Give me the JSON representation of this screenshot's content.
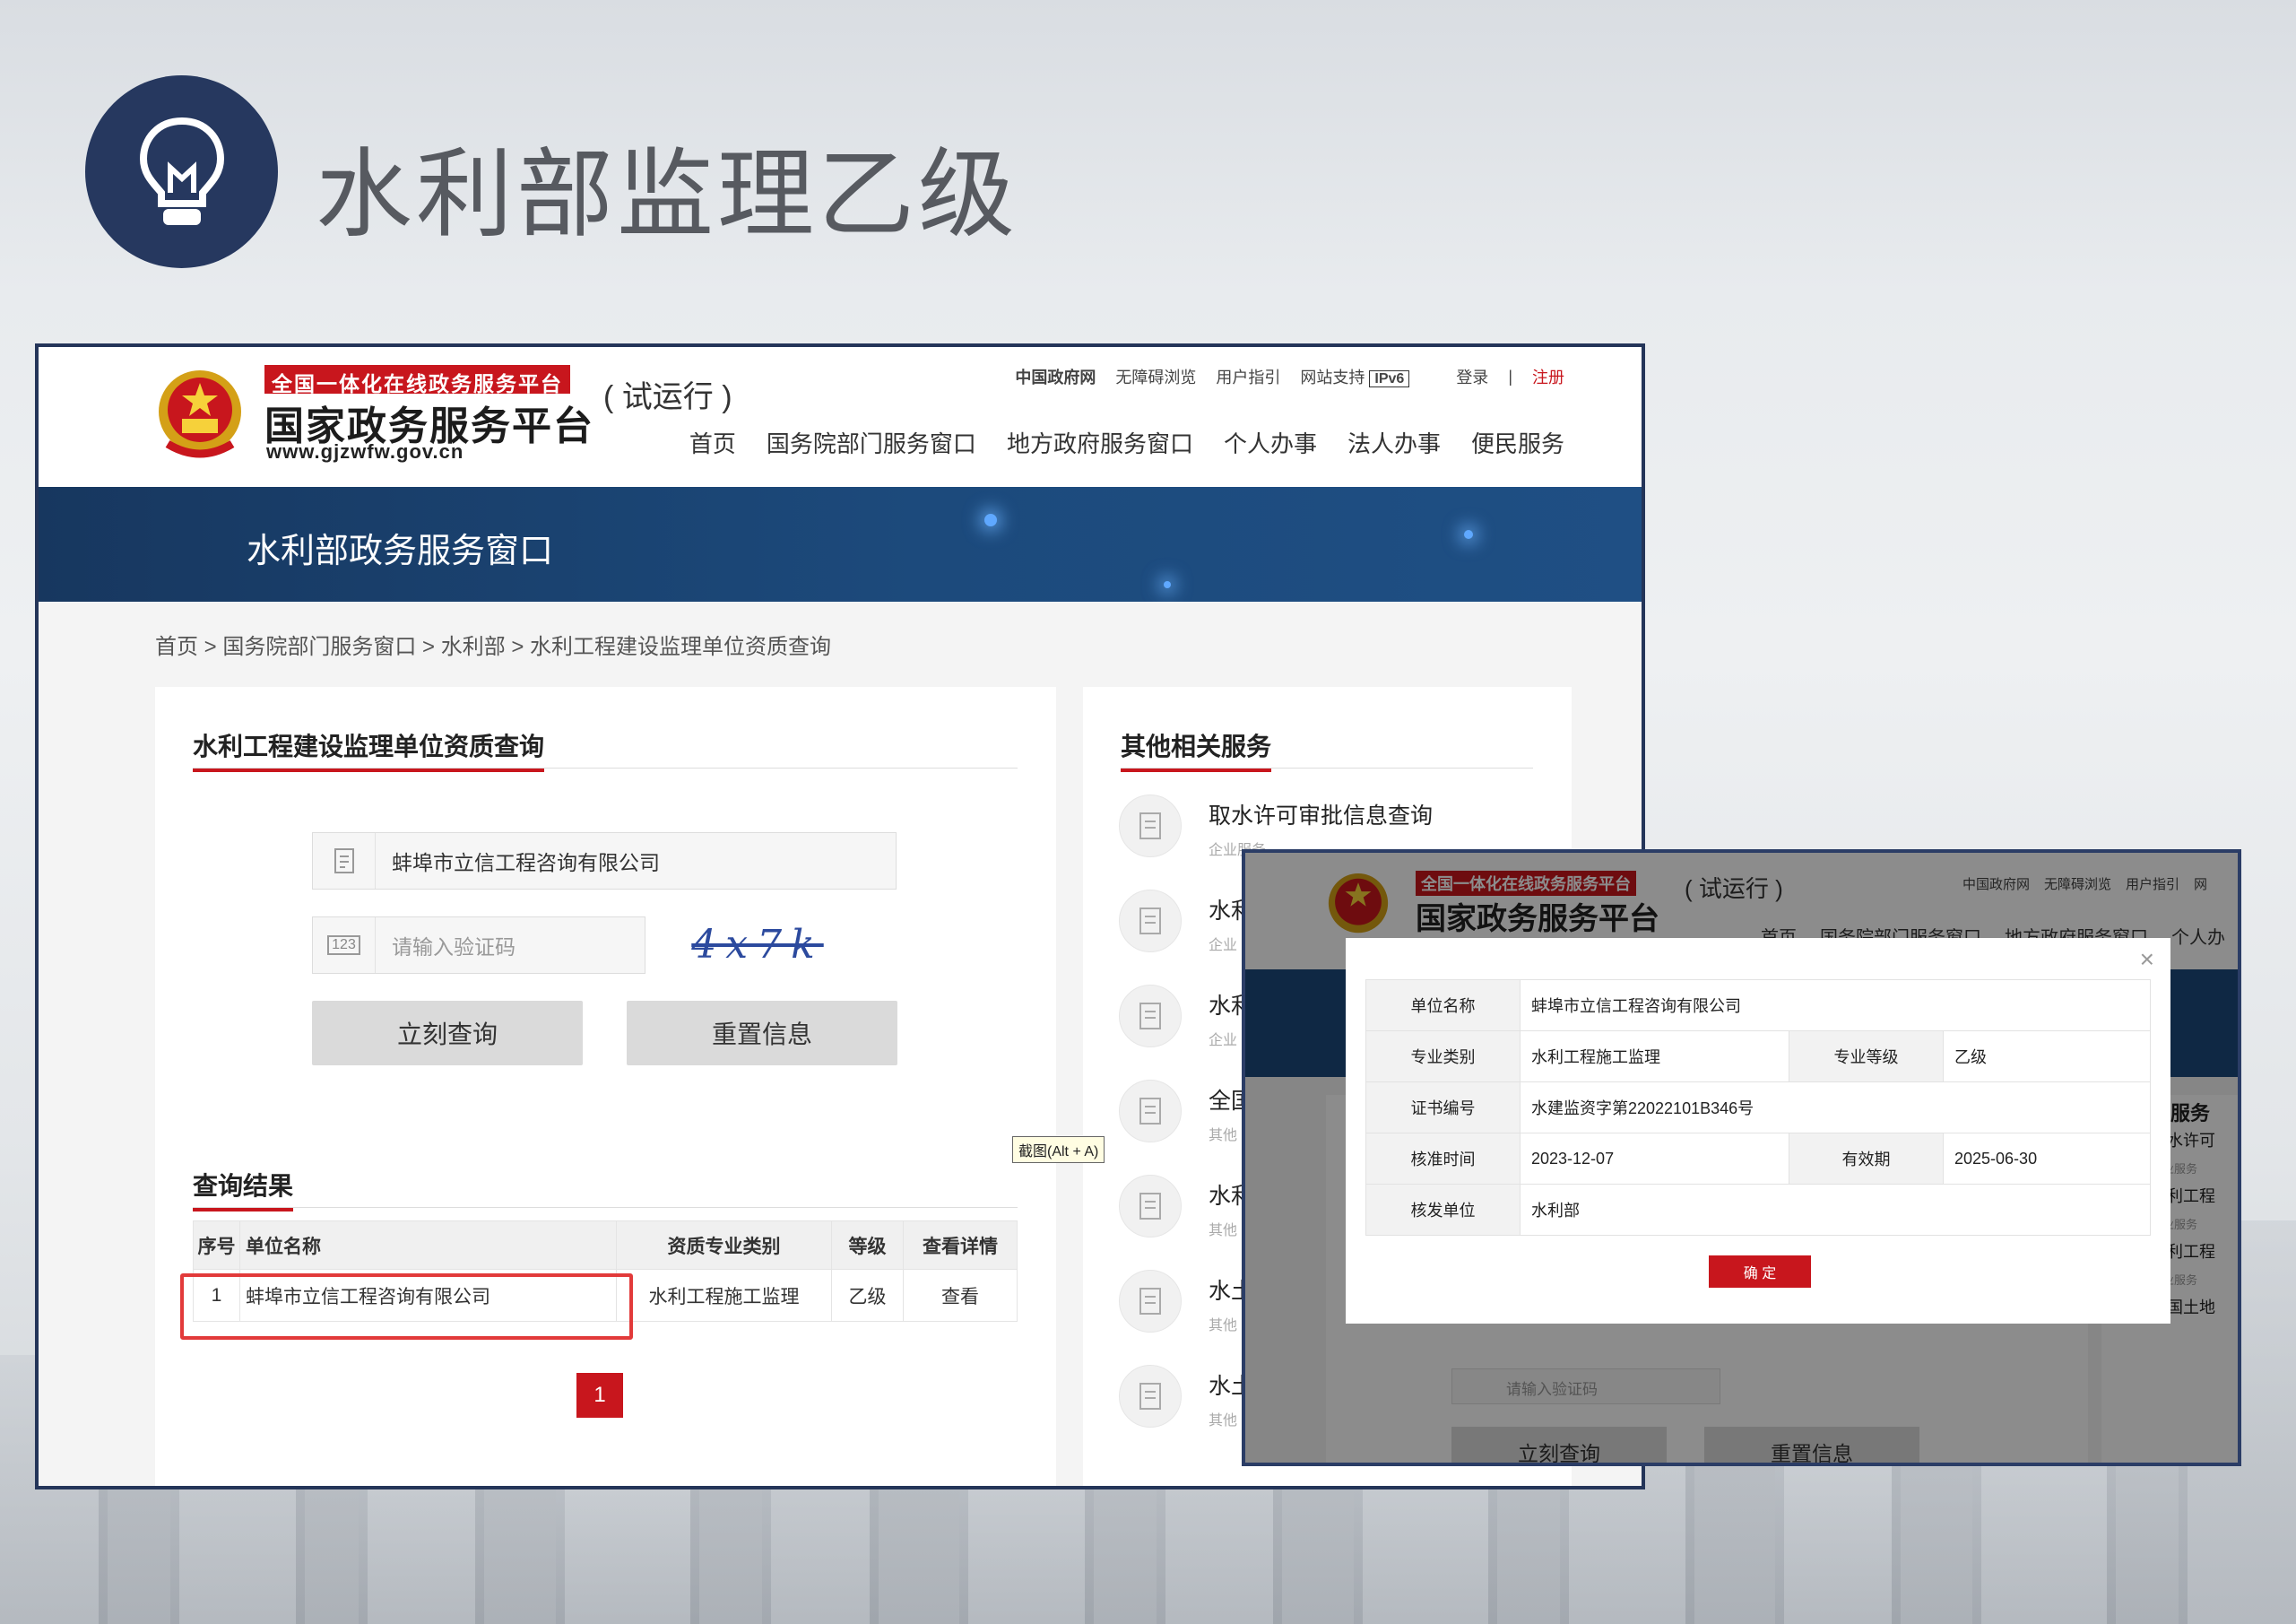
{
  "slide_title": "水利部监理乙级",
  "main": {
    "logo_red": "全国一体化在线政务服务平台",
    "logo_main": "国家政务服务平台",
    "logo_url": "www.gjzwfw.gov.cn",
    "trial": "( 试运行 )",
    "top_links": [
      "中国政府网",
      "无障碍浏览",
      "用户指引",
      "网站支持"
    ],
    "ipv6": "IPv6",
    "login": "登录",
    "divider": "|",
    "register": "注册",
    "nav": [
      "首页",
      "国务院部门服务窗口",
      "地方政府服务窗口",
      "个人办事",
      "法人办事",
      "便民服务"
    ],
    "banner_title": "水利部政务服务窗口",
    "breadcrumb": "首页 > 国务院部门服务窗口 > 水利部 > 水利工程建设监理单位资质查询",
    "query_title": "水利工程建设监理单位资质查询",
    "company_value": "蚌埠市立信工程咨询有限公司",
    "captcha_icon": "123",
    "captcha_placeholder": "请输入验证码",
    "captcha_image_text": "4x7k",
    "btn_query": "立刻查询",
    "btn_reset": "重置信息",
    "results_title": "查询结果",
    "table_headers": [
      "序号",
      "单位名称",
      "资质专业类别",
      "等级",
      "查看详情"
    ],
    "table_rows": [
      [
        "1",
        "蚌埠市立信工程咨询有限公司",
        "水利工程施工监理",
        "乙级",
        "查看"
      ]
    ],
    "page": "1",
    "other_title": "其他相关服务",
    "services": [
      {
        "name": "取水许可审批信息查询",
        "sub": "企业服务"
      },
      {
        "name": "水利",
        "sub": "企业"
      },
      {
        "name": "水利",
        "sub": "企业"
      },
      {
        "name": "全国",
        "sub": "其他"
      },
      {
        "name": "水利",
        "sub": "其他"
      },
      {
        "name": "水土",
        "sub": "其他"
      },
      {
        "name": "水土",
        "sub": "其他"
      }
    ],
    "tooltip": "截图(Alt + A)"
  },
  "popup": {
    "logo_red": "全国一体化在线政务服务平台",
    "logo_main": "国家政务服务平台",
    "trial": "( 试运行 )",
    "top_links": [
      "中国政府网",
      "无障碍浏览",
      "用户指引",
      "网"
    ],
    "nav": [
      "首页",
      "国务院部门服务窗口",
      "地方政府服务窗口",
      "个人办"
    ],
    "behind_right": [
      "关服务",
      "取水许可",
      "企业服务",
      "水利工程",
      "企业服务",
      "水利工程",
      "企业服务",
      "全国土地"
    ],
    "behind_captcha": "请输入验证码",
    "behind_query": "立刻查询",
    "behind_reset": "重置信息",
    "close": "×",
    "labels": {
      "unit": "单位名称",
      "major": "专业类别",
      "grade_label": "专业等级",
      "cert": "证书编号",
      "approve": "核准时间",
      "valid": "有效期",
      "issuer": "核发单位"
    },
    "values": {
      "unit": "蚌埠市立信工程咨询有限公司",
      "major": "水利工程施工监理",
      "grade": "乙级",
      "cert": "水建监资字第22022101B346号",
      "approve": "2023-12-07",
      "valid": "2025-06-30",
      "issuer": "水利部"
    },
    "ok": "确 定"
  },
  "colors": {
    "navy": "#26385f",
    "red": "#c8161d",
    "banner": "#1c4a7c"
  },
  "icons": [
    "lightbulb-icon",
    "emblem-icon",
    "document-icon",
    "close-icon"
  ]
}
